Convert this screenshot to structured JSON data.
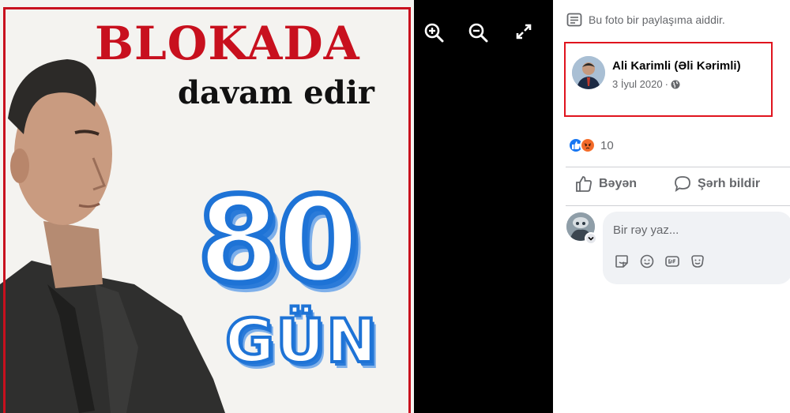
{
  "poster": {
    "title": "BLOKADA",
    "subtitle": "davam edir",
    "number": "80",
    "unit": "GÜN"
  },
  "viewer": {
    "tools": [
      {
        "icon": "zoom-in-icon"
      },
      {
        "icon": "zoom-out-icon"
      },
      {
        "icon": "fullscreen-icon"
      }
    ]
  },
  "panel": {
    "share_note": "Bu foto bir paylaşıma aiddir.",
    "author": {
      "name": "Ali Karimli (Əli Kərimli)",
      "date": "3 İyul 2020",
      "separator": "·",
      "privacy_icon": "globe-icon"
    },
    "reactions": {
      "types": [
        "like",
        "angry"
      ],
      "count": "10"
    },
    "actions": {
      "like_label": "Bəyən",
      "comment_label": "Şərh bildir"
    },
    "comment": {
      "placeholder": "Bir rəy yaz...",
      "tools": [
        "sticker-icon",
        "emoji-icon",
        "gif-icon",
        "sticker-face-icon"
      ]
    }
  },
  "colors": {
    "highlight": "#e0141e",
    "poster_red": "#c8101e",
    "poster_blue": "#1e73d6",
    "like_blue": "#1877f2",
    "angry_orange": "#f7712c"
  }
}
